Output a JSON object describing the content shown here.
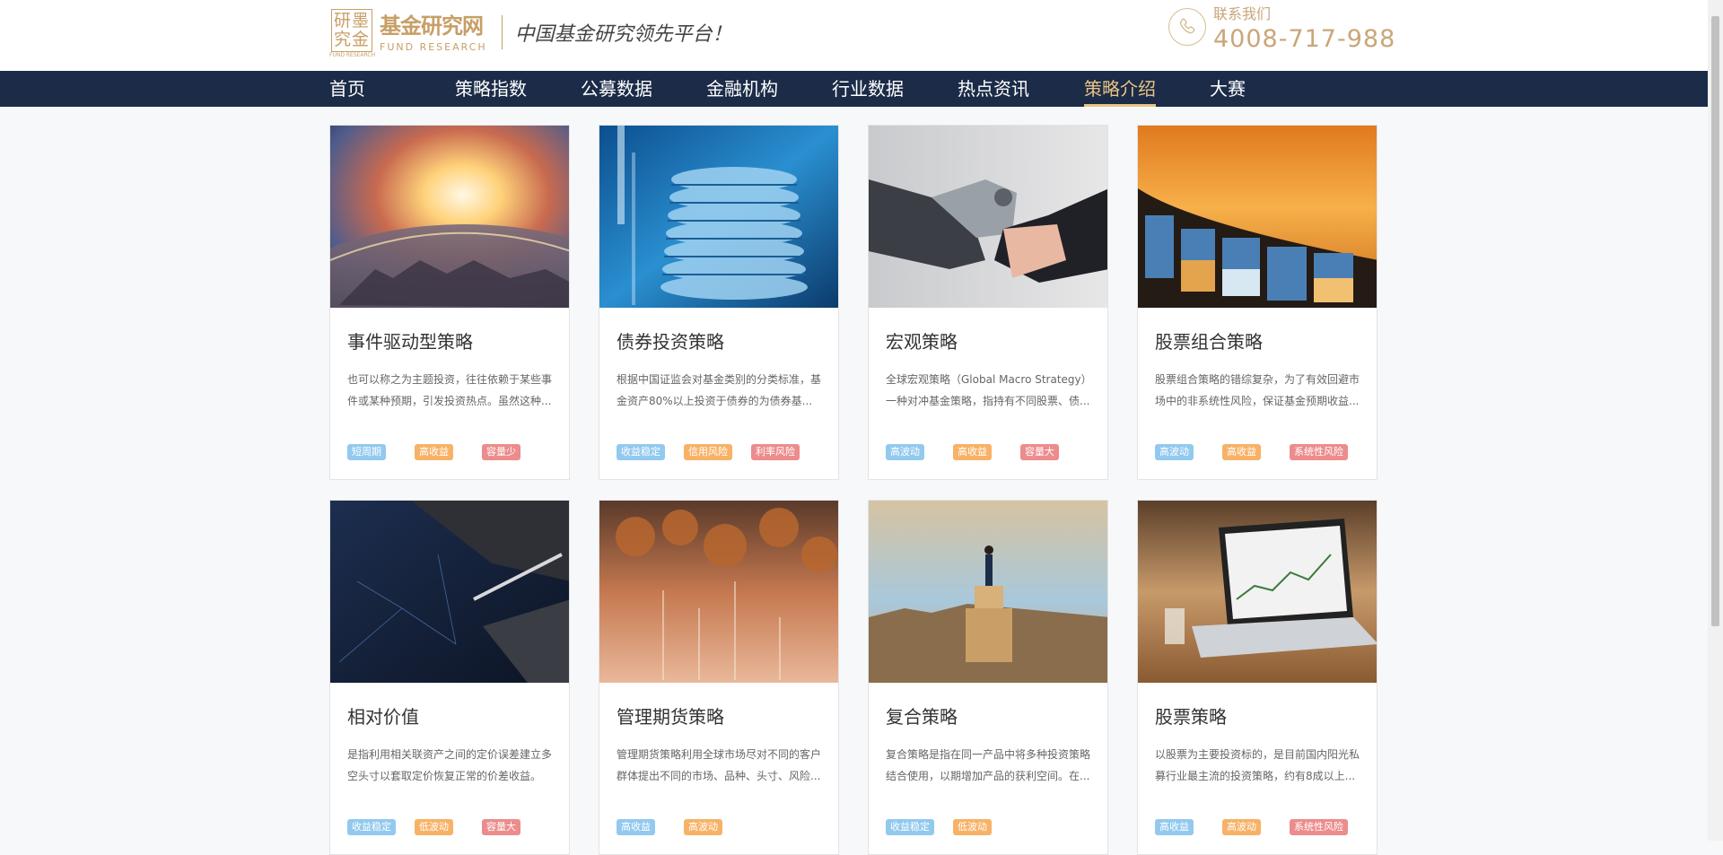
{
  "header": {
    "logo_seal_chars": [
      "研",
      "墨",
      "究",
      "金"
    ],
    "logo_seal_sub": "FUND RESEARCH",
    "brand_name": "基金研究网",
    "brand_en": "FUND RESEARCH",
    "slogan": "中国基金研究领先平台！",
    "contact_label": "联系我们",
    "contact_phone": "4008-717-988",
    "accent_color": "#c79f66"
  },
  "nav": {
    "items": [
      {
        "label": "首页"
      },
      {
        "label": "策略指数"
      },
      {
        "label": "公募数据"
      },
      {
        "label": "金融机构"
      },
      {
        "label": "行业数据"
      },
      {
        "label": "热点资讯"
      },
      {
        "label": "策略介绍",
        "active": true
      },
      {
        "label": "大赛"
      }
    ],
    "background": "#1b2b48",
    "active_color": "#e8c483"
  },
  "tag_colors": {
    "blue": "#92c9ef",
    "orange": "#f7b267",
    "red": "#ec8c8c"
  },
  "cards": [
    {
      "title": "事件驱动型策略",
      "desc": "也可以称之为主题投资，往往依赖于某些事件或某种预期，引发投资热点。虽然这种...",
      "image": "globe-city-sunrise",
      "tags": [
        {
          "label": "短周期",
          "color": "blue"
        },
        {
          "label": "高收益",
          "color": "orange"
        },
        {
          "label": "容量少",
          "color": "red"
        }
      ]
    },
    {
      "title": "债券投资策略",
      "desc": "根据中国证监会对基金类别的分类标准，基金资产80%以上投资于债券的为债券基...",
      "image": "coin-stacks",
      "tags": [
        {
          "label": "收益稳定",
          "color": "blue"
        },
        {
          "label": "信用风险",
          "color": "orange"
        },
        {
          "label": "利率风险",
          "color": "red"
        }
      ]
    },
    {
      "title": "宏观策略",
      "desc": "全球宏观策略（Global Macro Strategy）一种对冲基金策略，指持有不同股票、债...",
      "image": "robot-handshake",
      "tags": [
        {
          "label": "高波动",
          "color": "blue"
        },
        {
          "label": "高收益",
          "color": "orange"
        },
        {
          "label": "容量大",
          "color": "red"
        }
      ]
    },
    {
      "title": "股票组合策略",
      "desc": "股票组合策略的错综复杂，为了有效回避市场中的非系统性风险，保证基金预期收益...",
      "image": "film-strip-sunset",
      "tags": [
        {
          "label": "高波动",
          "color": "blue"
        },
        {
          "label": "高收益",
          "color": "orange"
        },
        {
          "label": "系统性风险",
          "color": "red"
        }
      ]
    },
    {
      "title": "相对价值",
      "desc": "是指利用相关联资产之间的定价误差建立多空头寸以套取定价恢复正常的价差收益。",
      "image": "dark-desk-pen",
      "tags": [
        {
          "label": "收益稳定",
          "color": "blue"
        },
        {
          "label": "低波动",
          "color": "orange"
        },
        {
          "label": "容量大",
          "color": "red"
        }
      ]
    },
    {
      "title": "管理期货策略",
      "desc": "管理期货策略利用全球市场尽对不同的客户群体提出不同的市场、品种、头寸、风险...",
      "image": "coins-numbers",
      "tags": [
        {
          "label": "高收益",
          "color": "blue"
        },
        {
          "label": "高波动",
          "color": "orange"
        }
      ]
    },
    {
      "title": "复合策略",
      "desc": "复合策略是指在同一产品中将多种投资策略结合使用，以期增加产品的获利空间。在...",
      "image": "man-on-blocks-city",
      "tags": [
        {
          "label": "收益稳定",
          "color": "blue"
        },
        {
          "label": "低波动",
          "color": "orange"
        }
      ]
    },
    {
      "title": "股票策略",
      "desc": "以股票为主要投资标的，是目前国内阳光私募行业最主流的投资策略，约有8成以上...",
      "image": "laptop-chart-desk",
      "tags": [
        {
          "label": "高收益",
          "color": "blue"
        },
        {
          "label": "高波动",
          "color": "orange"
        },
        {
          "label": "系统性风险",
          "color": "red"
        }
      ]
    }
  ]
}
